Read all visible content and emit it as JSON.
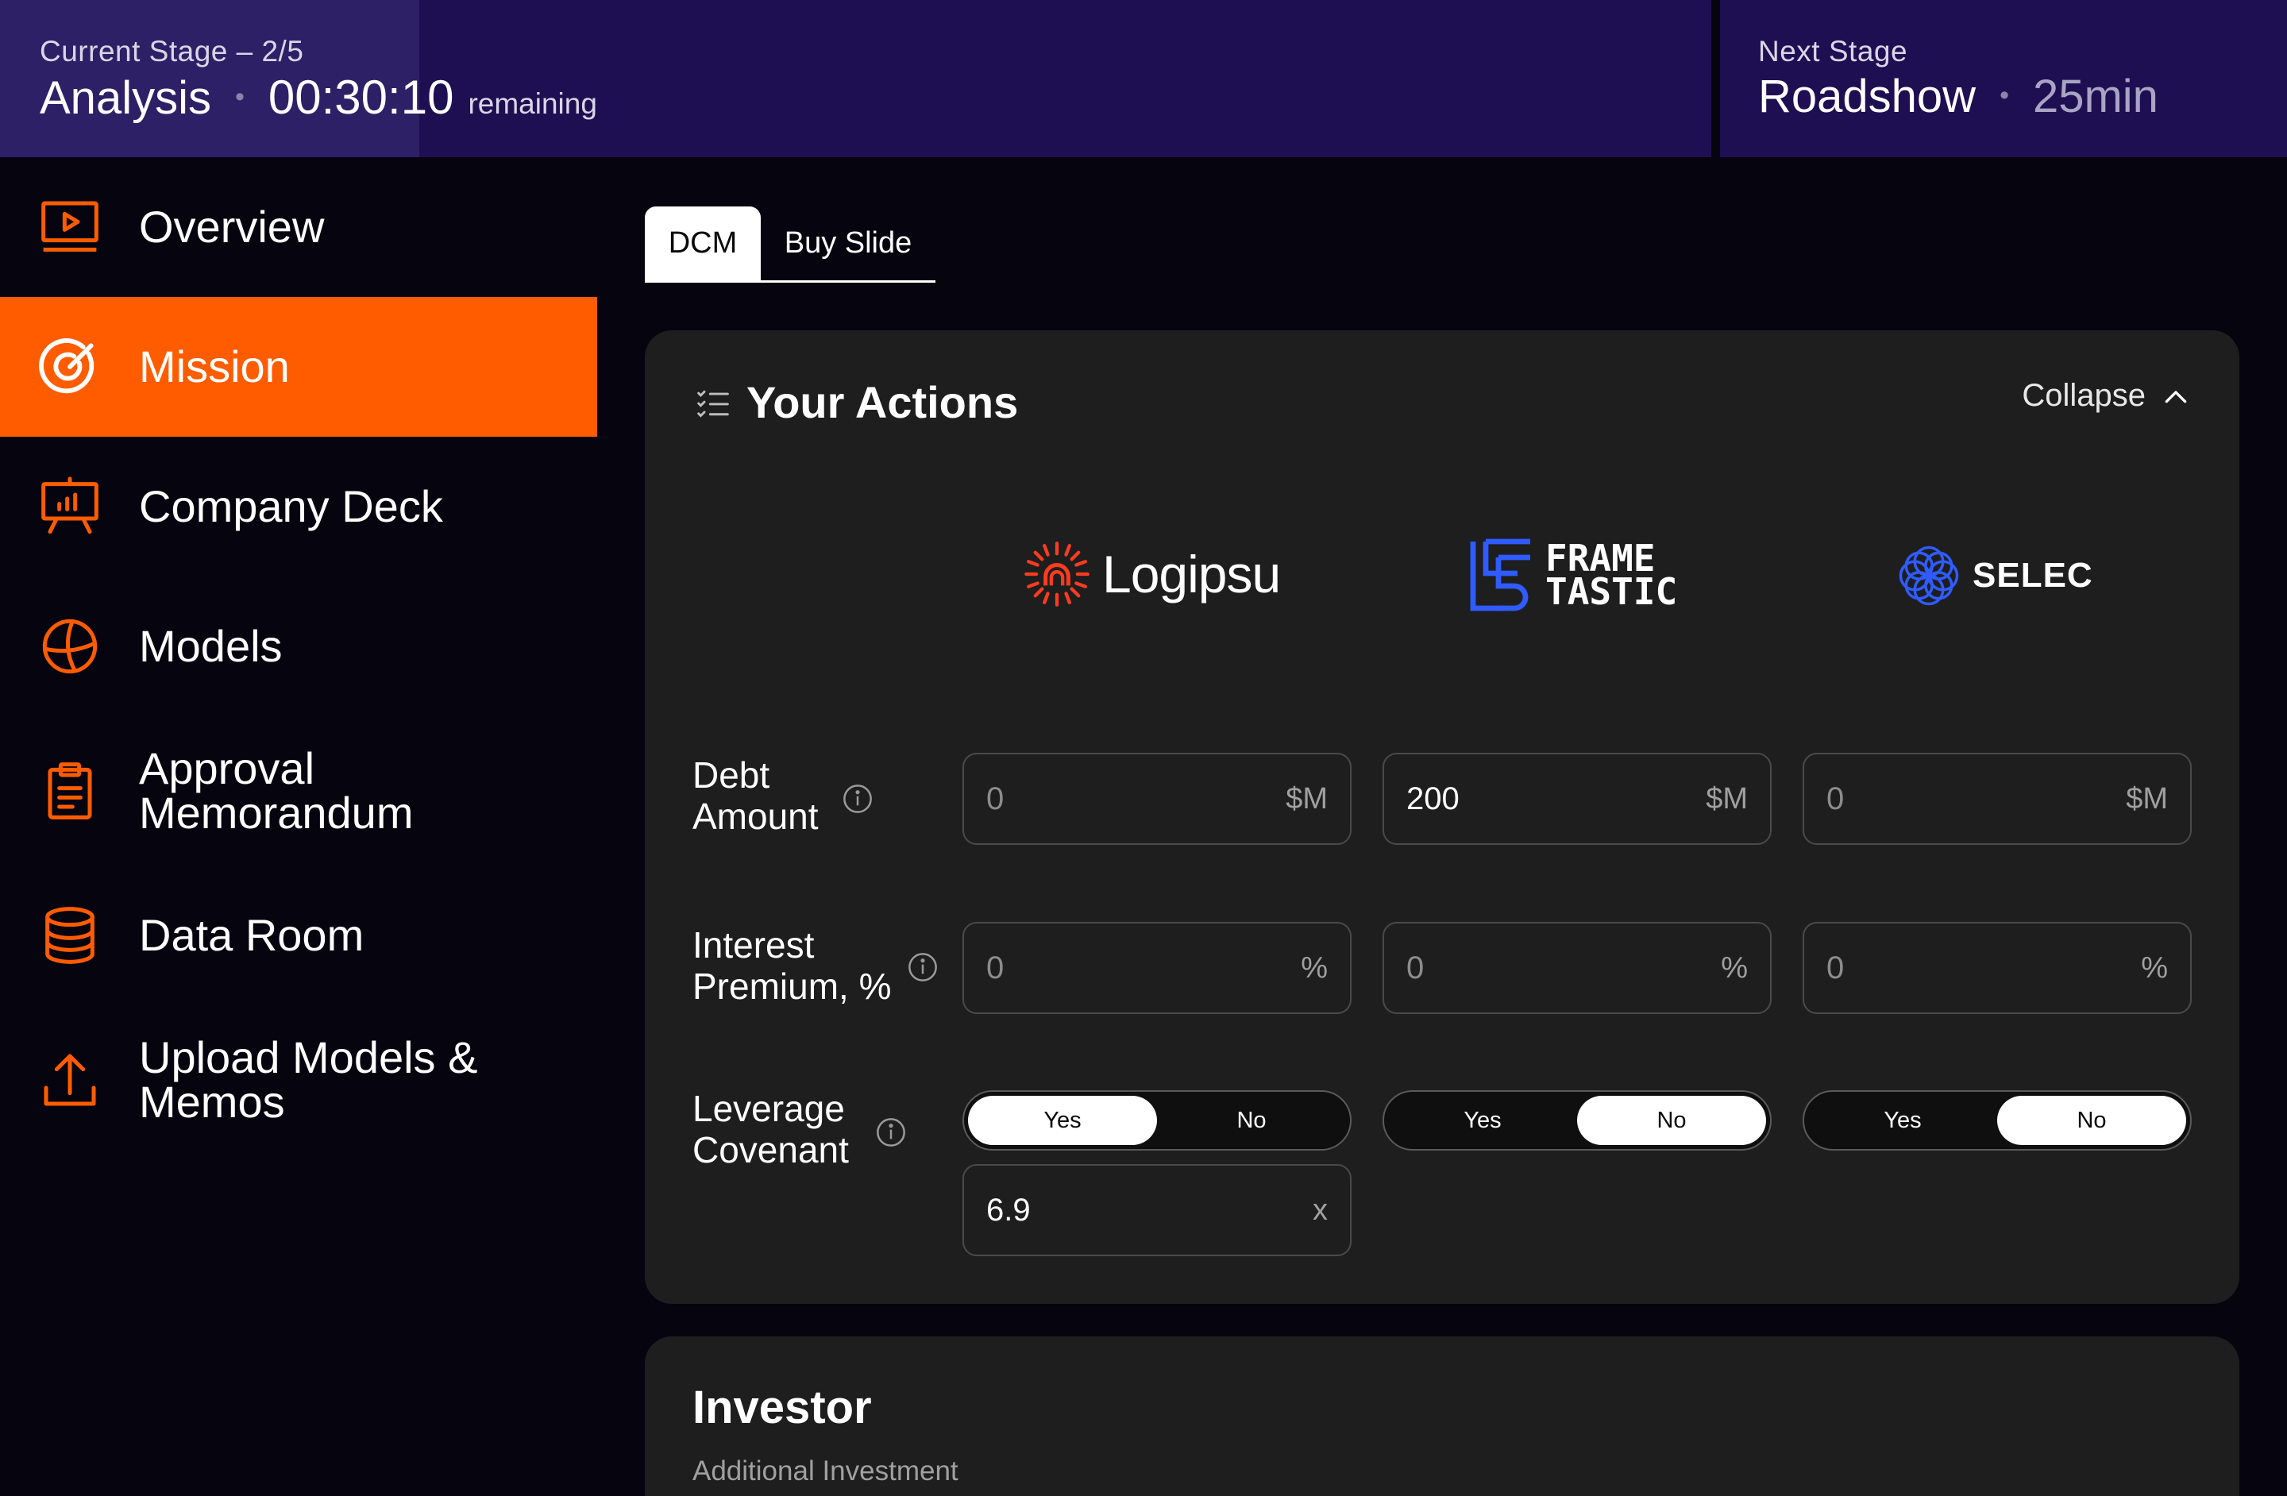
{
  "header": {
    "current_caption": "Current Stage – 2/5",
    "current_stage": "Analysis",
    "timer": "00:30:10",
    "remaining": "remaining",
    "next_caption": "Next Stage",
    "next_stage": "Roadshow",
    "next_duration": "25min",
    "separator": "•",
    "progress_fraction": 0.245
  },
  "sidebar": {
    "items": [
      {
        "label": "Overview",
        "icon": "play-screen-icon",
        "active": false
      },
      {
        "label": "Mission",
        "icon": "target-icon",
        "active": true
      },
      {
        "label": "Company Deck",
        "icon": "presentation-icon",
        "active": false
      },
      {
        "label": "Models",
        "icon": "globe-icon",
        "active": false
      },
      {
        "label": "Approval\nMemorandum",
        "label_line1": "Approval",
        "label_line2": "Memorandum",
        "icon": "clipboard-icon",
        "active": false
      },
      {
        "label": "Data Room",
        "icon": "database-icon",
        "active": false
      },
      {
        "label_line1": "Upload Models &",
        "label_line2": "Memos",
        "icon": "upload-icon",
        "active": false
      }
    ]
  },
  "tabs": [
    {
      "label": "DCM",
      "active": true
    },
    {
      "label": "Buy Slide",
      "active": false
    }
  ],
  "actions": {
    "title": "Your Actions",
    "collapse_label": "Collapse",
    "companies": [
      {
        "name": "Logipsu",
        "logo": "logipsu-logo"
      },
      {
        "name_line1": "FRAME",
        "name_line2": "TASTIC",
        "logo": "frametastic-logo"
      },
      {
        "name": "SELEC",
        "logo": "selec-logo"
      }
    ],
    "rows": {
      "debt": {
        "label_line1": "Debt",
        "label_line2": "Amount",
        "unit": "$M",
        "values": [
          "0",
          "200",
          "0"
        ]
      },
      "interest": {
        "label_line1": "Interest",
        "label_line2": "Premium, %",
        "unit": "%",
        "values": [
          "0",
          "0",
          "0"
        ]
      },
      "covenant": {
        "label_line1": "Leverage",
        "label_line2": "Covenant",
        "yes_label": "Yes",
        "no_label": "No",
        "selected": [
          "Yes",
          "No",
          "No"
        ],
        "multiple_value": "6.9",
        "multiple_unit": "x"
      }
    }
  },
  "investor": {
    "title": "Investor",
    "subtitle": "Additional Investment"
  },
  "colors": {
    "accent": "#ff5c00",
    "header_bg": "#1e0f52",
    "header_progress": "#2e2066",
    "panel_bg": "#1e1e1e",
    "page_bg": "#06040f",
    "logo_red": "#ff3b1f",
    "logo_blue": "#2f5bff"
  }
}
